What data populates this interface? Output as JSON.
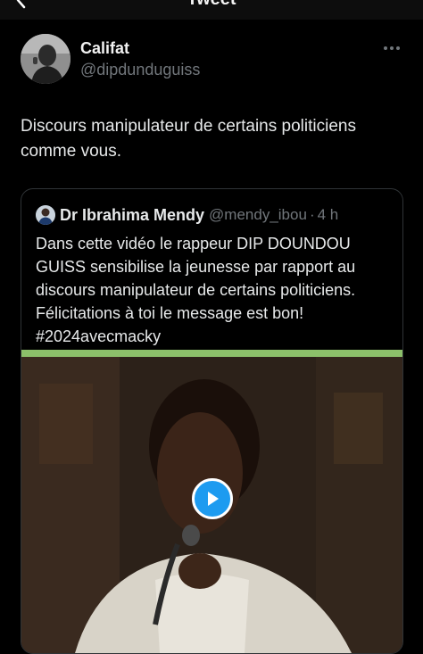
{
  "header": {
    "title": "Tweet",
    "back_icon": "chevron-left-icon"
  },
  "tweet": {
    "author": {
      "display_name": "Califat",
      "handle": "@dipdunduguiss"
    },
    "text": "Discours manipulateur de certains politiciens comme vous.",
    "more_icon": "more-dots-icon"
  },
  "quote": {
    "author": {
      "display_name": "Dr Ibrahima Mendy",
      "handle": "@mendy_ibou",
      "separator": "·",
      "time": "4 h"
    },
    "text": "Dans cette vidéo le rappeur DIP DOUNDOU GUISS sensibilise la jeunesse par rapport au discours manipulateur de certains politiciens. Félicitations à toi le message est bon! #2024avecmacky",
    "media": {
      "type": "video",
      "play_icon": "play-icon",
      "accent_bar_color": "#8cc06a"
    }
  },
  "colors": {
    "background": "#000000",
    "text": "#e7e9ea",
    "muted": "#71767b",
    "accent": "#1d9bf0"
  }
}
